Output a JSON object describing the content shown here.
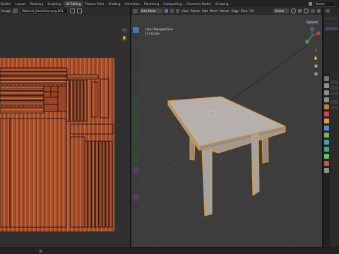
{
  "workspaces": {
    "left_label": "Builder",
    "tabs": [
      "Layout",
      "Modeling",
      "Sculpting",
      "UV Editing",
      "Texture Paint",
      "Shading",
      "Animation",
      "Rendering",
      "Compositing",
      "Geometry Nodes",
      "Scripting"
    ],
    "active_tab": "UV Editing",
    "scene_label": "Scene"
  },
  "uv_editor": {
    "header": {
      "image_menu": "Image",
      "image_name": "Material_BaseColor.png.001"
    }
  },
  "viewport": {
    "header": {
      "mode": "Edit Mode",
      "menus": [
        "View",
        "Select",
        "Add",
        "Mesh",
        "Vertex",
        "Edge",
        "Face",
        "UV"
      ],
      "transform_orientation": "Global",
      "options_label": "Options"
    },
    "overlay_text": {
      "view_name": "User Perspective",
      "object_name": "(1) Cube"
    },
    "gizmo": {
      "x": "X",
      "y": "Y",
      "z": "Z"
    }
  },
  "colors": {
    "accent": "#4772b3",
    "selection_orange": "#e8962e",
    "wood": "#9b4a2a"
  }
}
